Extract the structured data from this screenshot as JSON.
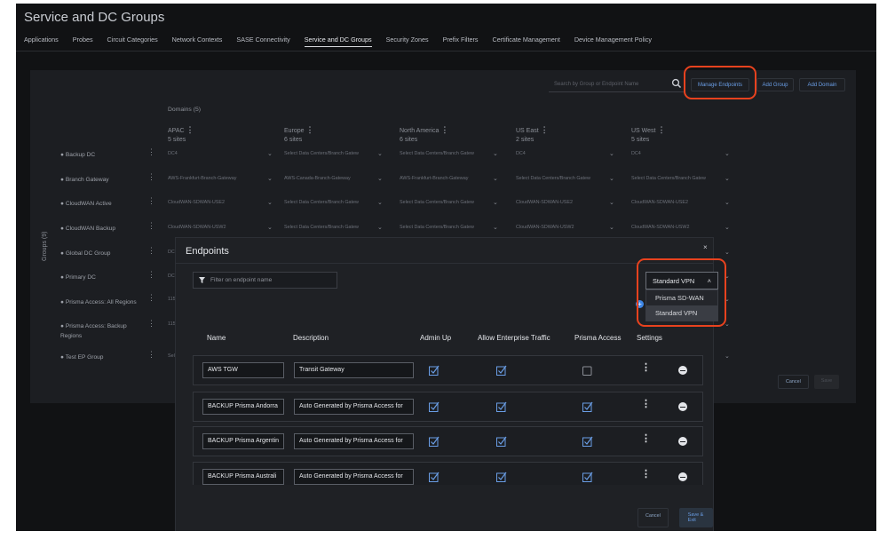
{
  "page_title": "Service and DC Groups",
  "tabs": [
    "Applications",
    "Probes",
    "Circuit Categories",
    "Network Contexts",
    "SASE Connectivity",
    "Service and DC Groups",
    "Security Zones",
    "Prefix Filters",
    "Certificate Management",
    "Device Management Policy"
  ],
  "active_tab": "Service and DC Groups",
  "search": {
    "placeholder": "Search by Group or Endpoint Name"
  },
  "buttons": {
    "manage_endpoints": "Manage Endpoints",
    "add_group": "Add Group",
    "add_domain": "Add Domain",
    "cancel": "Cancel",
    "save": "Save"
  },
  "domains_label": "Domains (5)",
  "groups_label": "Groups (9)",
  "domains": [
    {
      "name": "APAC",
      "sites": "5 sites"
    },
    {
      "name": "Europe",
      "sites": "6 sites"
    },
    {
      "name": "North America",
      "sites": "6 sites"
    },
    {
      "name": "US East",
      "sites": "2 sites"
    },
    {
      "name": "US West",
      "sites": "5 sites"
    }
  ],
  "groups": [
    {
      "name": "Backup DC",
      "cells": [
        "DC4",
        "Select Data Centers/Branch Gatew",
        "Select Data Centers/Branch Gatew",
        "DC4",
        "DC4"
      ]
    },
    {
      "name": "Branch Gateway",
      "cells": [
        "AWS-Frankfurt-Branch-Gateway",
        "AWS-Canada-Branch-Gateway",
        "AWS-Frankfurt-Branch-Gateway",
        "Select Data Centers/Branch Gatew",
        "Select Data Centers/Branch Gatew"
      ]
    },
    {
      "name": "CloudWAN Active",
      "cells": [
        "CloudWAN-SDWAN-USE2",
        "Select Data Centers/Branch Gatew",
        "Select Data Centers/Branch Gatew",
        "CloudWAN-SDWAN-USE2",
        "CloudWAN-SDWAN-USE2"
      ]
    },
    {
      "name": "CloudWAN Backup",
      "cells": [
        "CloudWAN-SDWAN-USW2",
        "Select Data Centers/Branch Gatew",
        "Select Data Centers/Branch Gatew",
        "CloudWAN-SDWAN-USW2",
        "CloudWAN-SDWAN-USW2"
      ]
    },
    {
      "name": "Global DC Group",
      "cells": [
        "DC",
        "",
        "",
        "",
        ""
      ]
    },
    {
      "name": "Primary DC",
      "cells": [
        "DC",
        "",
        "",
        "",
        ""
      ]
    },
    {
      "name": "Prisma Access: All Regions",
      "cells": [
        "115",
        "",
        "",
        "",
        ""
      ]
    },
    {
      "name": "Prisma Access: Backup Regions",
      "cells": [
        "115",
        "",
        "",
        "",
        ""
      ]
    },
    {
      "name": "Test EP Group",
      "cells": [
        "Sel",
        "",
        "",
        "",
        ""
      ]
    }
  ],
  "modal": {
    "title": "Endpoints",
    "close": "×",
    "filter_placeholder": "Filter on endpoint name",
    "vpn_selected": "Standard VPN",
    "vpn_options": [
      "Prisma SD-WAN",
      "Standard VPN"
    ],
    "columns": [
      "Name",
      "Description",
      "Admin Up",
      "Allow Enterprise Traffic",
      "Prisma Access",
      "Settings"
    ],
    "rows": [
      {
        "name": "AWS TGW",
        "description": "Transit Gateway",
        "admin_up": true,
        "allow_enterprise": true,
        "prisma_access": false
      },
      {
        "name": "BACKUP Prisma Andorra",
        "description": "Auto Generated by Prisma Access for",
        "admin_up": true,
        "allow_enterprise": true,
        "prisma_access": true
      },
      {
        "name": "BACKUP Prisma Argentin",
        "description": "Auto Generated by Prisma Access for",
        "admin_up": true,
        "allow_enterprise": true,
        "prisma_access": true
      },
      {
        "name": "BACKUP Prisma Australi",
        "description": "Auto Generated by Prisma Access for",
        "admin_up": true,
        "allow_enterprise": true,
        "prisma_access": true
      }
    ],
    "cancel": "Cancel",
    "save_exit": "Save & Exit"
  },
  "colors": {
    "accent": "#3d86e6",
    "highlight": "#e8421e",
    "background": "#111214",
    "panel": "#1c1e22"
  }
}
